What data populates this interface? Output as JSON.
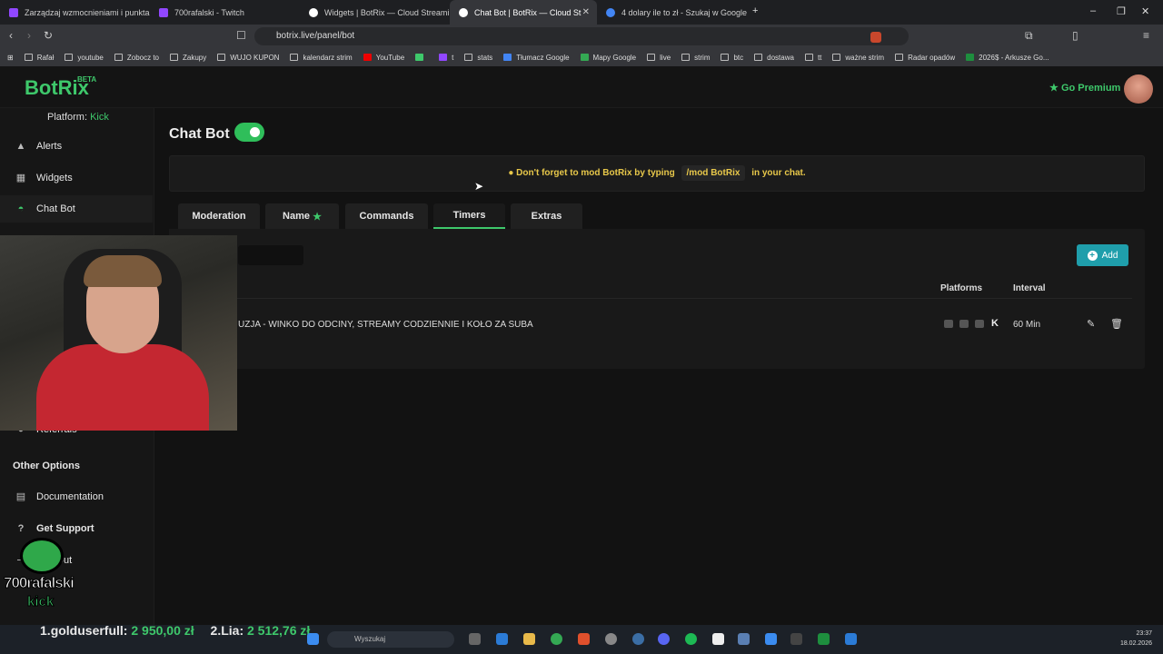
{
  "browser": {
    "tabs": [
      {
        "title": "Zarządzaj wzmocnieniami i punktam",
        "color": "#9147ff"
      },
      {
        "title": "700rafalski - Twitch",
        "color": "#9147ff"
      },
      {
        "title": "Widgets | BotRix — Cloud Streaming",
        "color": "#ffffff"
      },
      {
        "title": "Chat Bot | BotRix — Cloud Strea",
        "color": "#ffffff"
      },
      {
        "title": "4 dolary ile to zł - Szukaj w Google",
        "color": "#4285f4"
      }
    ],
    "url": "botrix.live/panel/bot",
    "bookmarks": [
      "Rafał",
      "youtube",
      "Zobocz to",
      "Zakupy",
      "WUJO KUPON",
      "kalendarz strim",
      "YouTube",
      "t",
      "stats",
      "Tłumacz Google",
      "Mapy Google",
      "live",
      "strim",
      "btc",
      "dostawa",
      "tt",
      "ważne strim",
      "Radar opadów",
      "2026$ - Arkusze Go..."
    ]
  },
  "header": {
    "logo": "BotRix",
    "beta": "BETA",
    "premium": "Go Premium"
  },
  "sidebar": {
    "platform_label": "Platform:",
    "platform_value": "Kick",
    "items": [
      {
        "label": "Alerts",
        "icon": "warning-icon"
      },
      {
        "label": "Widgets",
        "icon": "grid-icon"
      },
      {
        "label": "Chat Bot",
        "icon": "robot-icon"
      },
      {
        "label": "Referrals",
        "icon": "people-icon"
      }
    ],
    "other_options_heading": "Other Options",
    "other_items": [
      {
        "label": "Documentation",
        "icon": "book-icon"
      },
      {
        "label": "Get Support",
        "icon": "question-icon"
      },
      {
        "label": "Log Out",
        "icon": "logout-icon"
      }
    ]
  },
  "main": {
    "title": "Chat Bot",
    "bot_enabled": true,
    "notice": {
      "before": "Don't forget to mod BotRix by typing",
      "command": "/mod BotRix",
      "after": "in your chat."
    },
    "tabs": [
      "Moderation",
      "Name",
      "Commands",
      "Timers",
      "Extras"
    ],
    "active_tab": "Timers",
    "add_button": "Add",
    "table": {
      "headers": {
        "platforms": "Platforms",
        "interval": "Interval"
      },
      "rows": [
        {
          "message": "UZJA - WINKO DO ODCINY, STREAMY CODZIENNIE I KOŁO ZA SUBA",
          "platform_mark": "K",
          "interval": "60 Min"
        }
      ]
    }
  },
  "overlay": {
    "streamer": "700rafalski",
    "kick_label": "kick",
    "ticker": [
      {
        "rank": "1.",
        "name": "golduserfull:",
        "amount": "2 950,00 zł"
      },
      {
        "rank": "2.",
        "name": "Lia:",
        "amount": "2 512,76 zł"
      }
    ]
  },
  "taskbar": {
    "search_placeholder": "Wyszukaj",
    "time": "23:37",
    "date": "18.02.2026"
  }
}
